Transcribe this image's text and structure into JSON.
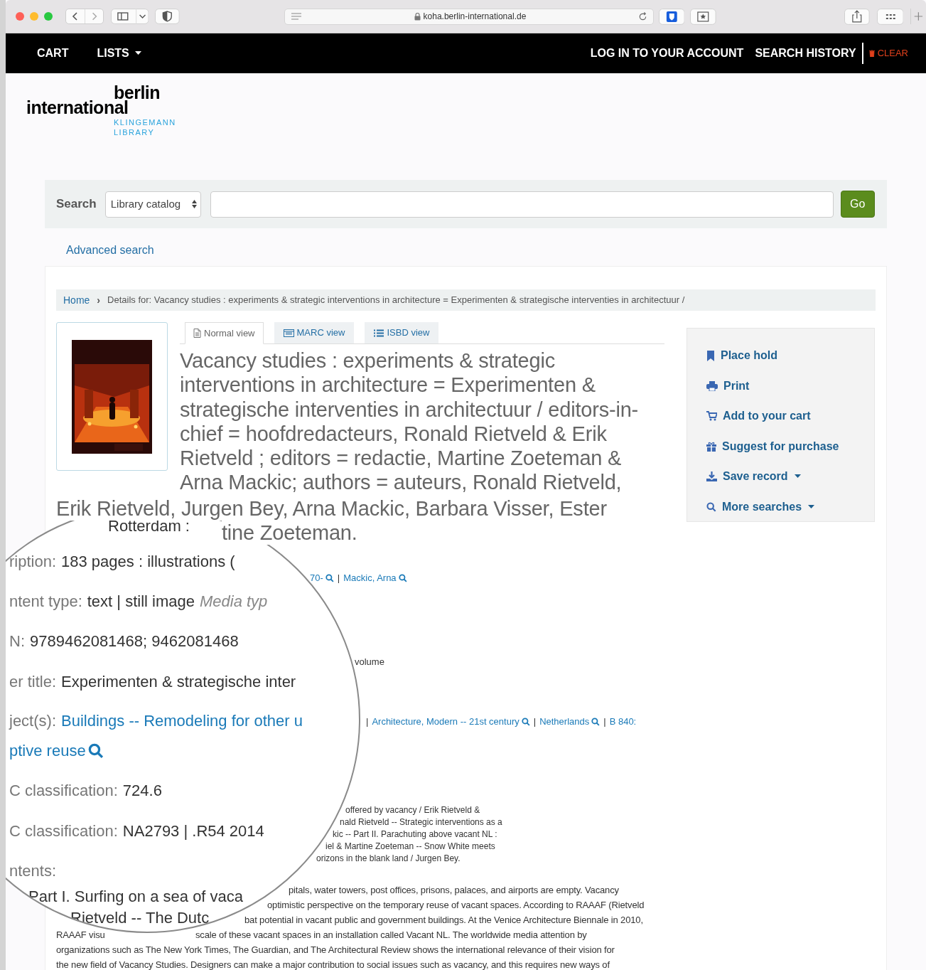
{
  "browser": {
    "url": "koha.berlin-international.de"
  },
  "navbar": {
    "left": [
      {
        "label": "CART",
        "dropdown": false
      },
      {
        "label": "LISTS",
        "dropdown": true
      }
    ],
    "right": [
      {
        "label": "LOG IN TO YOUR ACCOUNT"
      },
      {
        "label": "SEARCH HISTORY"
      }
    ],
    "clear": "CLEAR"
  },
  "logo": {
    "line1": "berlin",
    "line2": "international",
    "line3": "KLINGEMANN",
    "line4": "LIBRARY"
  },
  "search": {
    "label": "Search",
    "scope": "Library catalog",
    "button": "Go"
  },
  "advanced_search": "Advanced search",
  "breadcrumb": {
    "home": "Home",
    "separator": "›",
    "current": "Details for: Vacancy studies : experiments & strategic interventions in architecture = Experimenten & strategische interventies in architectuur /"
  },
  "cover": {
    "kind": "picture"
  },
  "tabs": [
    {
      "label": "Normal view",
      "selected": true
    },
    {
      "label": "MARC view",
      "selected": false
    },
    {
      "label": "ISBD view",
      "selected": false
    }
  ],
  "title": "Vacancy studies : experiments & strategic interventions in architecture = Experimenten & strategische interventies in architectuur / editors-in-chief = hoofdredacteurs, Ronald Rietveld & Erik Rietveld ; editors = redactie, Martine Zoeteman & Arna Mackic; authors = auteurs, Ronald Rietveld,",
  "title_continued": "Erik Rietveld, Jurgen Bey, Arna Mackic, Barbara Visser, Ester",
  "title_tail": "tine Zoeteman.",
  "actions": [
    {
      "label": "Place hold",
      "dropdown": false
    },
    {
      "label": "Print",
      "dropdown": false
    },
    {
      "label": "Add to your cart",
      "dropdown": false
    },
    {
      "label": "Suggest for purchase",
      "dropdown": false
    },
    {
      "label": "Save record",
      "dropdown": true
    },
    {
      "label": "More searches",
      "dropdown": true
    }
  ],
  "authors_row": [
    {
      "kind": "link",
      "text": "70-",
      "search_icon": true
    },
    {
      "kind": "sep",
      "text": "|"
    },
    {
      "kind": "link",
      "text": "Mackic, Arna",
      "search_icon": true
    }
  ],
  "volume_note": "volume",
  "subjects_row": [
    {
      "kind": "sep",
      "text": "|"
    },
    {
      "kind": "link",
      "text": "Architecture, Modern -- 21st century",
      "search_icon": true
    },
    {
      "kind": "sep",
      "text": "|"
    },
    {
      "kind": "link",
      "text": "Netherlands",
      "search_icon": true
    },
    {
      "kind": "sep",
      "text": "|"
    },
    {
      "kind": "link",
      "text": "B 840:",
      "search_icon": false
    }
  ],
  "contents_lines": [
    "offered by vacancy / Erik Rietveld &",
    "nald Rietveld -- Strategic interventions as a",
    "kic -- Part II. Parachuting above vacant NL :",
    "iel & Martine Zoeteman -- Snow White meets",
    "orizons in the blank land / Jurgen Bey."
  ],
  "abstract_lines": [
    [
      "pitals, water towers, post offices, prisons, palaces, and airports are empty. Vacancy"
    ],
    [
      "optimistic perspective on the temporary reuse of vacant spaces. According to RAAAF (Rietveld"
    ],
    [
      "bat potential in vacant public and government buildings. At the Venice Architecture Biennale in 2010,"
    ],
    [
      "RAAAF visu",
      "scale of these vacant spaces in an installation called Vacant NL. The worldwide media attention by"
    ],
    [
      "organizations such as The New York Times, The Guardian, and The Architectural Review shows the international relevance of their vision for"
    ],
    [
      "the new field of Vacancy Studies. Designers can make a major contribution to social issues such as vacancy, and this requires new ways of"
    ]
  ],
  "magnifier": {
    "lines": [
      [
        {
          "kind": "value",
          "text": "Rotterdam :"
        }
      ],
      [
        {
          "kind": "label",
          "text": "ription:"
        },
        {
          "kind": "value",
          "text": "183 pages : illustrations ("
        }
      ],
      [
        {
          "kind": "label",
          "text": "ntent type:"
        },
        {
          "kind": "value",
          "text": "text | still image"
        },
        {
          "kind": "note",
          "text": "Media typ"
        }
      ],
      [
        {
          "kind": "label",
          "text": "N:"
        },
        {
          "kind": "value",
          "text": "9789462081468; 9462081468"
        }
      ],
      [
        {
          "kind": "label",
          "text": "er title:"
        },
        {
          "kind": "value",
          "text": "Experimenten & strategische inter"
        }
      ],
      [
        {
          "kind": "label",
          "text": "ject(s):"
        },
        {
          "kind": "link",
          "text": "Buildings -- Remodeling for other u",
          "search_icon": false
        }
      ],
      [
        {
          "kind": "link",
          "text": "ptive reuse",
          "search_icon": true
        }
      ],
      [
        {
          "kind": "label",
          "text": "C classification:"
        },
        {
          "kind": "value",
          "text": "724.6"
        }
      ],
      [
        {
          "kind": "label",
          "text": "C classification:"
        },
        {
          "kind": "value",
          "text": "NA2793 | .R54 2014"
        }
      ],
      [
        {
          "kind": "label",
          "text": "ntents:"
        }
      ],
      [
        {
          "kind": "value",
          "text": "Part I. Surfing on a sea of vaca"
        }
      ],
      [
        {
          "kind": "value",
          "text": "Rietveld -- The Dutc"
        }
      ]
    ]
  }
}
